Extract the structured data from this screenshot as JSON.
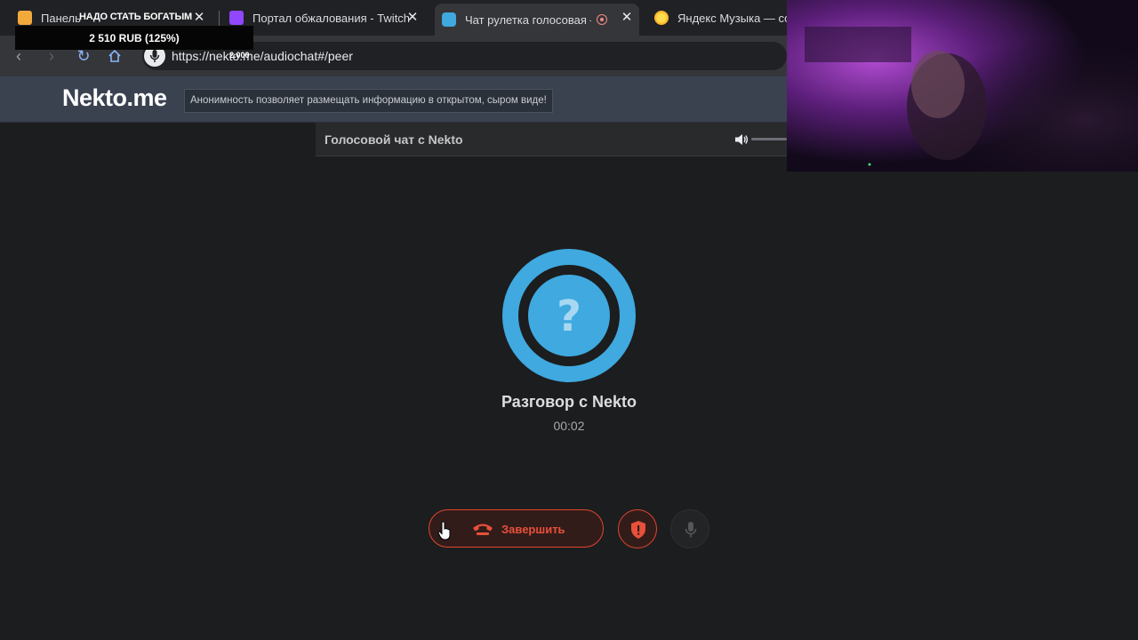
{
  "browser": {
    "tabs": [
      {
        "title": "Панель",
        "active": false
      },
      {
        "title": "Портал обжалования - Twitch",
        "active": false
      },
      {
        "title": "Чат рулетка голосовая —",
        "active": true
      },
      {
        "title": "Яндекс Музыка — соби",
        "active": false
      }
    ],
    "url": "https://nekto.me/audiochat#/peer"
  },
  "overlay": {
    "donation_title": "НАДО СТАТЬ БОГАТЫМ",
    "donation_amount": "2 510 RUB (125%)",
    "small_text": "2.000"
  },
  "site": {
    "logo": "Nekto.me",
    "slogan": "Анонимность позволяет размещать информацию в открытом, сыром виде!",
    "chat_title": "Голосовой чат с Nekto"
  },
  "call": {
    "avatar_symbol": "?",
    "title": "Разговор с Nekto",
    "timer": "00:02",
    "end_label": "Завершить"
  },
  "colors": {
    "accent_blue": "#3fa9e0",
    "danger_red": "#e0462f"
  }
}
